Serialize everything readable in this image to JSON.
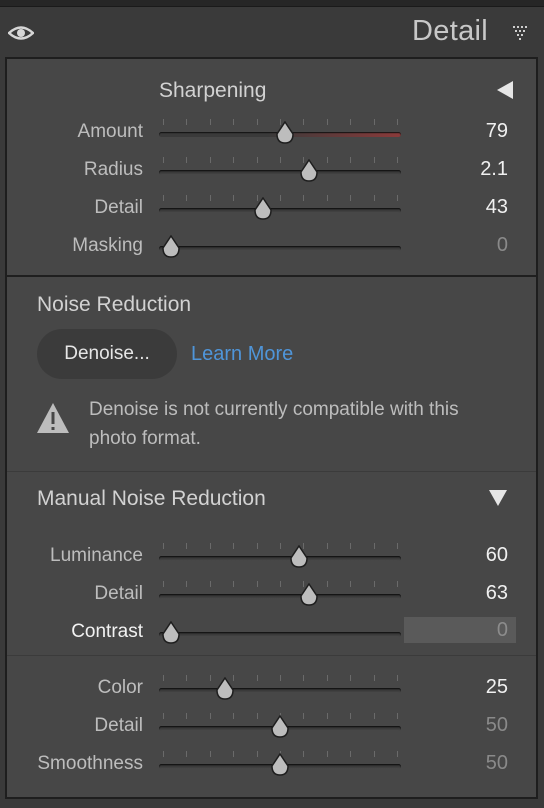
{
  "header": {
    "title": "Detail"
  },
  "sharpening": {
    "title": "Sharpening",
    "sliders": [
      {
        "label": "Amount",
        "value": "79",
        "fraction": 0.52
      },
      {
        "label": "Radius",
        "value": "2.1",
        "fraction": 0.62
      },
      {
        "label": "Detail",
        "value": "43",
        "fraction": 0.43
      },
      {
        "label": "Masking",
        "value": "0",
        "fraction": 0.0
      }
    ]
  },
  "noise_reduction": {
    "title": "Noise Reduction",
    "denoise_label": "Denoise...",
    "learn_more": "Learn More",
    "warning": "Denoise is not currently compatible with this photo format."
  },
  "manual_noise": {
    "title": "Manual Noise Reduction",
    "luminance": [
      {
        "label": "Luminance",
        "value": "60",
        "fraction": 0.58
      },
      {
        "label": "Detail",
        "value": "63",
        "fraction": 0.62
      },
      {
        "label": "Contrast",
        "value": "0",
        "fraction": 0.0
      }
    ],
    "color": [
      {
        "label": "Color",
        "value": "25",
        "fraction": 0.27
      },
      {
        "label": "Detail",
        "value": "50",
        "fraction": 0.5
      },
      {
        "label": "Smoothness",
        "value": "50",
        "fraction": 0.5
      }
    ]
  },
  "colors": {
    "accent_link": "#4f95d9",
    "amount_track_red": "#8a3a3a"
  }
}
